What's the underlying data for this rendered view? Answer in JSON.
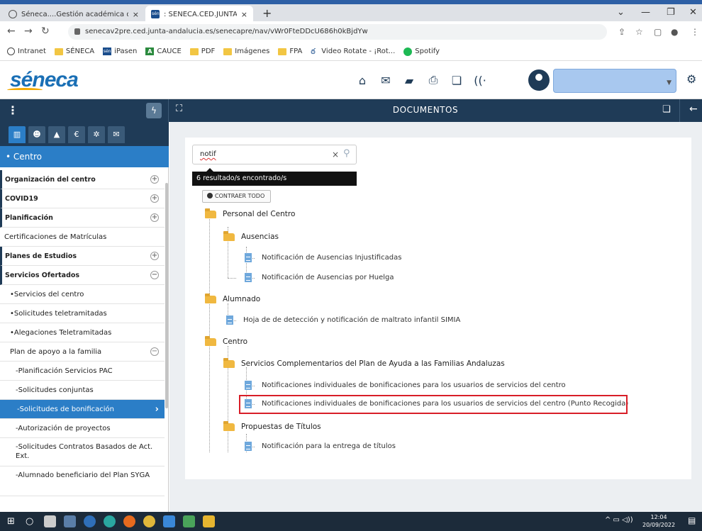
{
  "browser": {
    "tabs": [
      {
        "title": "Séneca....Gestión académica de l",
        "close": "×"
      },
      {
        "title": ": SENECA.CED.JUNTA DE ANDAL",
        "close": "×"
      }
    ],
    "new_tab": "+",
    "window_controls": {
      "minimize": "—",
      "maximize": "❐",
      "close": "✕",
      "chevron": "⌄"
    },
    "url": "senecav2pre.ced.junta-andalucia.es/senecapre/nav/vWr0FteDDcU686h0kBjdYw",
    "bookmarks": [
      {
        "label": "Intranet",
        "icon": "globe-icon"
      },
      {
        "label": "SÉNECA",
        "icon": "folder-icon"
      },
      {
        "label": "iPasen",
        "icon": "seneca-icon"
      },
      {
        "label": "CAUCE",
        "icon": "andalucia-icon"
      },
      {
        "label": "PDF",
        "icon": "folder-icon"
      },
      {
        "label": "Imágenes",
        "icon": "folder-icon"
      },
      {
        "label": "FPA",
        "icon": "folder-icon"
      },
      {
        "label": "Video Rotate - ¡Rot...",
        "icon": "video-icon"
      },
      {
        "label": "Spotify",
        "icon": "spotify-icon"
      }
    ]
  },
  "app": {
    "logo": "séneca",
    "toolbar_title": "DOCUMENTOS"
  },
  "sidebar": {
    "header": "• Centro",
    "items": [
      {
        "label": "Organización del centro",
        "toggle": "+"
      },
      {
        "label": "COVID19",
        "toggle": "+"
      },
      {
        "label": "Planificación",
        "toggle": "+"
      },
      {
        "label": "Certificaciones de Matrículas"
      },
      {
        "label": "Planes de Estudios",
        "toggle": "+"
      },
      {
        "label": "Servicios Ofertados",
        "toggle": "−"
      },
      {
        "label": "•Servicios del centro"
      },
      {
        "label": "•Solicitudes teletramitadas"
      },
      {
        "label": "•Alegaciones Teletramitadas"
      },
      {
        "label": "Plan de apoyo a la familia",
        "toggle": "−"
      },
      {
        "label": "-Planificación Servicios PAC"
      },
      {
        "label": "-Solicitudes conjuntas"
      },
      {
        "label": "-Solicitudes de bonificación",
        "arrow": "›"
      },
      {
        "label": "-Autorización de proyectos"
      },
      {
        "label": "-Solicitudes Contratos Basados de Act. Ext."
      },
      {
        "label": "-Alumnado beneficiario del Plan SYGA"
      }
    ]
  },
  "search": {
    "value": "notif",
    "clear": "×",
    "result_text": "6 resultado/s encontrado/s",
    "collapse_label": "CONTRAER TODO"
  },
  "tree": {
    "personal": "Personal del Centro",
    "ausencias": "Ausencias",
    "f1": "Notificación de Ausencias Injustificadas",
    "f2": "Notificación de Ausencias por Huelga",
    "alumnado": "Alumnado",
    "f3": "Hoja de de detección y notificación de maltrato infantil SIMIA",
    "centro": "Centro",
    "servicios": "Servicios Complementarios del Plan de Ayuda a las Familias Andaluzas",
    "f4": "Notificaciones individuales de bonificaciones para los usuarios de servicios del centro",
    "f5": "Notificaciones individuales de bonificaciones para los usuarios de servicios del centro (Punto Recogida)",
    "propuestas": "Propuestas de Títulos",
    "f6": "Notificación para la entrega de títulos"
  },
  "taskbar": {
    "time": "12:04",
    "date": "20/09/2022"
  },
  "colors": {
    "navy": "#1f3b57",
    "accent_blue": "#2b7ec7",
    "highlight_red": "#d81e28",
    "folder_yellow": "#f0b840"
  }
}
